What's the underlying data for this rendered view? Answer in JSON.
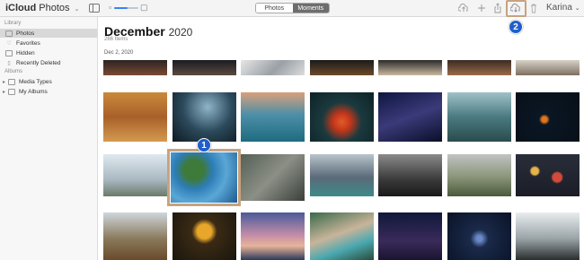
{
  "app": {
    "brand": "iCloud",
    "name": "Photos"
  },
  "toolbar": {
    "zoom_level": 0.55,
    "view_tabs": [
      "Photos",
      "Moments"
    ],
    "active_tab": "Moments",
    "user_name": "Karina",
    "icons": [
      "sidebar-toggle-icon",
      "upload-icon",
      "add-icon",
      "share-icon",
      "download-icon",
      "trash-icon"
    ]
  },
  "sidebar": {
    "library_heading": "Library",
    "library_items": [
      {
        "label": "Photos",
        "icon": "photos-icon",
        "selected": true
      },
      {
        "label": "Favorites",
        "icon": "heart-icon",
        "selected": false
      },
      {
        "label": "Hidden",
        "icon": "hidden-icon",
        "selected": false
      },
      {
        "label": "Recently Deleted",
        "icon": "trash-icon",
        "selected": false
      }
    ],
    "albums_heading": "Albums",
    "album_items": [
      {
        "label": "Media Types",
        "icon": "folder-icon"
      },
      {
        "label": "My Albums",
        "icon": "folder-icon"
      }
    ]
  },
  "main": {
    "month": "December",
    "year": "2020",
    "items_count": "266 Items",
    "date_label": "Dec 2, 2020"
  },
  "annotations": {
    "badge_1": "1",
    "badge_2": "2"
  },
  "colors": {
    "highlight": "#c9a27e",
    "badge": "#1f5fcc",
    "active_tab": "#6d6d6d",
    "accent": "#3b82f6"
  }
}
